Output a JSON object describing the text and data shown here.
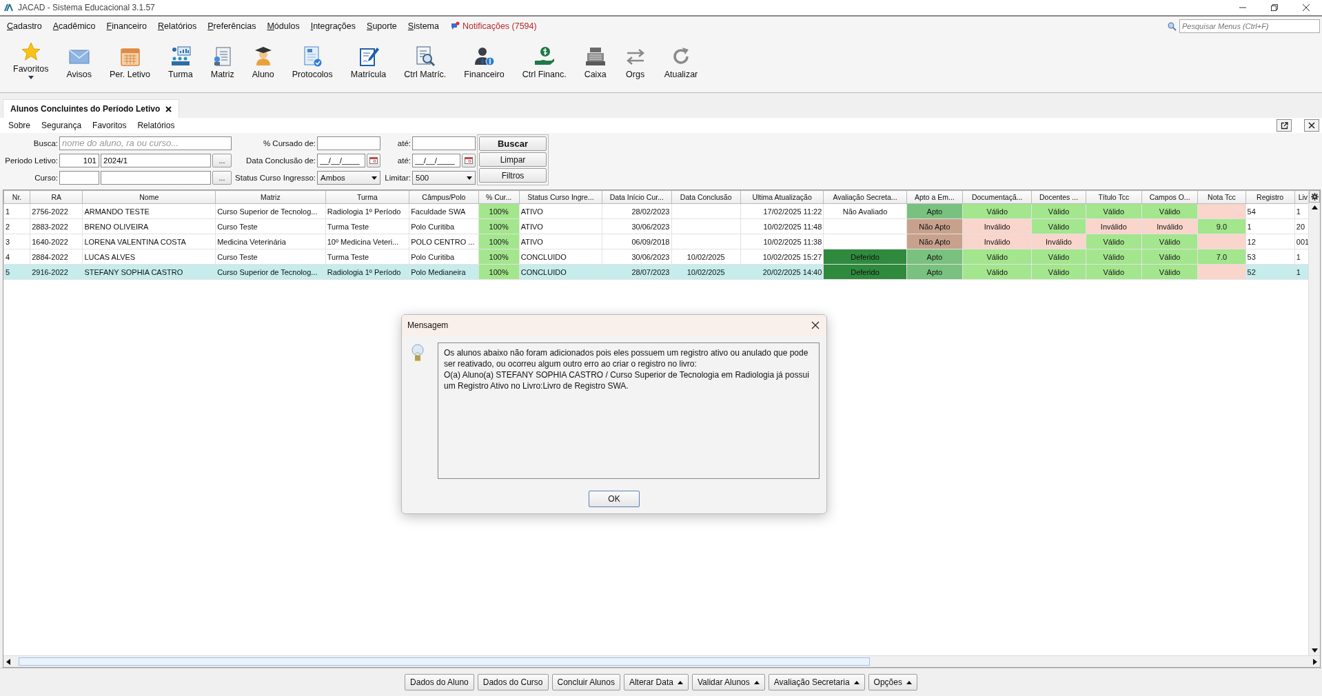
{
  "window": {
    "title": "JACAD - Sistema Educacional 3.1.57"
  },
  "menu": [
    "Cadastro",
    "Acadêmico",
    "Financeiro",
    "Relatórios",
    "Preferências",
    "Módulos",
    "Integrações",
    "Suporte",
    "Sistema"
  ],
  "notifications": "Notificações (7594)",
  "menu_search": {
    "placeholder": "Pesquisar Menus (Ctrl+F)"
  },
  "toolbar": [
    {
      "label": "Favoritos"
    },
    {
      "label": "Avisos"
    },
    {
      "label": "Per. Letivo"
    },
    {
      "label": "Turma"
    },
    {
      "label": "Matriz"
    },
    {
      "label": "Aluno"
    },
    {
      "label": "Protocolos"
    },
    {
      "label": "Matrícula"
    },
    {
      "label": "Ctrl Matríc."
    },
    {
      "label": "Financeiro"
    },
    {
      "label": "Ctrl Financ."
    },
    {
      "label": "Caixa"
    },
    {
      "label": "Orgs"
    },
    {
      "label": "Atualizar"
    }
  ],
  "tab": {
    "title": "Alunos Concluintes do Período Letivo"
  },
  "submenu": [
    "Sobre",
    "Segurança",
    "Favoritos",
    "Relatórios"
  ],
  "filters": {
    "busca": {
      "label": "Busca:",
      "placeholder": "nome do aluno, ra ou curso..."
    },
    "periodo": {
      "label": "Periodo Letivo:",
      "code": "101",
      "value": "2024/1",
      "button": "..."
    },
    "curso": {
      "label": "Curso:",
      "button": "..."
    },
    "cursado_de": {
      "label": "% Cursado de:"
    },
    "cursado_ate": {
      "label": "até:"
    },
    "conclusao_de": {
      "label": "Data Conclusão de:",
      "value": "__/__/____"
    },
    "conclusao_ate": {
      "label": "até:",
      "value": "__/__/____"
    },
    "status": {
      "label": "Status Curso Ingresso:",
      "value": "Ambos"
    },
    "limitar": {
      "label": "Limitar:",
      "value": "500"
    }
  },
  "actions": [
    "Buscar",
    "Limpar",
    "Filtros"
  ],
  "table": {
    "columns": [
      "Nr.",
      "RA",
      "Nome",
      "Matriz",
      "Turma",
      "Câmpus/Polo",
      "% Cur...",
      "Status Curso Ingre...",
      "Data Início Cur...",
      "Data Conclusão",
      "Ultima Atualização",
      "Avaliação Secreta...",
      "Apto a Em...",
      "Documentaçã...",
      "Docentes ...",
      "Título Tcc",
      "Campos O...",
      "Nota Tcc",
      "Registro",
      "Liv"
    ],
    "rows": [
      {
        "selected": false,
        "cells": [
          {
            "text": "1"
          },
          {
            "text": "2756-2022"
          },
          {
            "text": "ARMANDO TESTE"
          },
          {
            "text": "Curso Superior de Tecnolog..."
          },
          {
            "text": "Radiologia 1º Período"
          },
          {
            "text": "Faculdade SWA"
          },
          {
            "text": "100%",
            "color": "#a3e68d"
          },
          {
            "text": "ATIVO"
          },
          {
            "text": "28/02/2023"
          },
          {},
          {
            "text": "17/02/2025 11:22"
          },
          {
            "text": "Não Avaliado"
          },
          {
            "text": "Apto",
            "color": "#79c17e"
          },
          {
            "text": "Válido",
            "color": "#a3e68d"
          },
          {
            "text": "Válido",
            "color": "#a3e68d"
          },
          {
            "text": "Válido",
            "color": "#a3e68d"
          },
          {
            "text": "Válido",
            "color": "#a3e68d"
          },
          {
            "color": "#f9d5cc"
          },
          {
            "text": "54"
          },
          {
            "text": "1"
          }
        ]
      },
      {
        "selected": false,
        "cells": [
          {
            "text": "2"
          },
          {
            "text": "2883-2022"
          },
          {
            "text": "BRENO OLIVEIRA"
          },
          {
            "text": "Curso Teste"
          },
          {
            "text": "Turma Teste"
          },
          {
            "text": "Polo Curitiba"
          },
          {
            "text": "100%",
            "color": "#a3e68d"
          },
          {
            "text": "ATIVO"
          },
          {
            "text": "30/06/2023"
          },
          {},
          {
            "text": "10/02/2025 11:48"
          },
          {},
          {
            "text": "Não Apto",
            "color": "#c8a18c"
          },
          {
            "text": "Inválido",
            "color": "#f9d5cc"
          },
          {
            "text": "Válido",
            "color": "#a3e68d"
          },
          {
            "text": "Inválido",
            "color": "#f9d5cc"
          },
          {
            "text": "Inválido",
            "color": "#f9d5cc"
          },
          {
            "text": "9.0",
            "color": "#a3e68d"
          },
          {
            "text": "1"
          },
          {
            "text": "20"
          }
        ]
      },
      {
        "selected": false,
        "cells": [
          {
            "text": "3"
          },
          {
            "text": "1640-2022"
          },
          {
            "text": "LORENA VALENTINA COSTA"
          },
          {
            "text": "Medicina Veterinária"
          },
          {
            "text": "10º  Medicina Veteri..."
          },
          {
            "text": "POLO CENTRO ..."
          },
          {
            "text": "100%",
            "color": "#a3e68d"
          },
          {
            "text": "ATIVO"
          },
          {
            "text": "06/09/2018"
          },
          {},
          {
            "text": "10/02/2025 11:38"
          },
          {},
          {
            "text": "Não Apto",
            "color": "#c8a18c"
          },
          {
            "text": "Inválido",
            "color": "#f9d5cc"
          },
          {
            "text": "Inválido",
            "color": "#f9d5cc"
          },
          {
            "text": "Válido",
            "color": "#a3e68d"
          },
          {
            "text": "Válido",
            "color": "#a3e68d"
          },
          {
            "color": "#f9d5cc"
          },
          {
            "text": "12"
          },
          {
            "text": "001"
          }
        ]
      },
      {
        "selected": false,
        "cells": [
          {
            "text": "4"
          },
          {
            "text": "2884-2022"
          },
          {
            "text": "LUCAS ALVES"
          },
          {
            "text": "Curso Teste"
          },
          {
            "text": "Turma Teste"
          },
          {
            "text": "Polo Curitiba"
          },
          {
            "text": "100%",
            "color": "#a3e68d"
          },
          {
            "text": "CONCLUIDO"
          },
          {
            "text": "30/06/2023"
          },
          {
            "text": "10/02/2025"
          },
          {
            "text": "10/02/2025 15:27"
          },
          {
            "text": "Deferido",
            "color": "#2f8a3e"
          },
          {
            "text": "Apto",
            "color": "#79c17e"
          },
          {
            "text": "Válido",
            "color": "#a3e68d"
          },
          {
            "text": "Válido",
            "color": "#a3e68d"
          },
          {
            "text": "Válido",
            "color": "#a3e68d"
          },
          {
            "text": "Válido",
            "color": "#a3e68d"
          },
          {
            "text": "7.0",
            "color": "#a3e68d"
          },
          {
            "text": "53"
          },
          {
            "text": "1"
          }
        ]
      },
      {
        "selected": true,
        "cells": [
          {
            "text": "5"
          },
          {
            "text": "2916-2022"
          },
          {
            "text": "STEFANY SOPHIA CASTRO"
          },
          {
            "text": "Curso Superior de Tecnolog..."
          },
          {
            "text": "Radiologia 1º Período"
          },
          {
            "text": "Polo Medianeira"
          },
          {
            "text": "100%",
            "color": "#a3e68d"
          },
          {
            "text": "CONCLUIDO"
          },
          {
            "text": "28/07/2023"
          },
          {
            "text": "10/02/2025"
          },
          {
            "text": "20/02/2025 14:40"
          },
          {
            "text": "Deferido",
            "color": "#2f8a3e"
          },
          {
            "text": "Apto",
            "color": "#79c17e"
          },
          {
            "text": "Válido",
            "color": "#a3e68d"
          },
          {
            "text": "Válido",
            "color": "#a3e68d"
          },
          {
            "text": "Válido",
            "color": "#a3e68d"
          },
          {
            "text": "Válido",
            "color": "#a3e68d"
          },
          {
            "color": "#f9d5cc"
          },
          {
            "text": "52"
          },
          {
            "text": "1"
          }
        ]
      }
    ]
  },
  "dialog": {
    "title": "Mensagem",
    "message": "Os alunos abaixo não foram adicionados pois eles possuem um registro ativo ou anulado que pode ser reativado, ou ocorreu algum outro erro ao criar o registro no livro:\nO(a) Aluno(a) STEFANY SOPHIA CASTRO / Curso Superior de Tecnologia em Radiologia já possui um Registro Ativo no Livro:Livro de Registro SWA.",
    "button": "OK"
  },
  "bottom_buttons": [
    {
      "label": "Dados do Aluno",
      "menu": false
    },
    {
      "label": "Dados do Curso",
      "menu": false
    },
    {
      "label": "Concluir Alunos",
      "menu": false
    },
    {
      "label": "Alterar Data",
      "menu": true
    },
    {
      "label": "Validar Alunos",
      "menu": true
    },
    {
      "label": "Avaliação Secretaria",
      "menu": true
    },
    {
      "label": "Opções",
      "menu": true
    }
  ]
}
